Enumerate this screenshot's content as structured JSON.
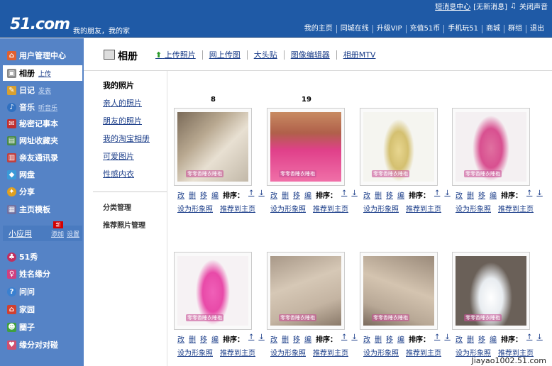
{
  "header": {
    "top_links": [
      "短消息中心",
      "[无新消息]",
      "关闭声音"
    ],
    "logo": "51.com",
    "slogan": "我的朋友，我的家",
    "nav": [
      "我的主页",
      "同城在线",
      "升级VIP",
      "充值51币",
      "手机玩51",
      "商城",
      "群组",
      "退出"
    ]
  },
  "sidebar": {
    "items": [
      {
        "label": "用户管理中心",
        "sub": ""
      },
      {
        "label": "相册",
        "sub": "上传"
      },
      {
        "label": "日记",
        "sub": "发表"
      },
      {
        "label": "音乐",
        "sub": "听音乐"
      },
      {
        "label": "秘密记事本",
        "sub": ""
      },
      {
        "label": "网址收藏夹",
        "sub": ""
      },
      {
        "label": "亲友通讯录",
        "sub": ""
      },
      {
        "label": "网盘",
        "sub": ""
      },
      {
        "label": "分享",
        "sub": ""
      },
      {
        "label": "主页模板",
        "sub": ""
      }
    ],
    "apps_title": "小应用",
    "apps_add": "添加",
    "apps_settings": "设置",
    "new_badge": "新",
    "apps": [
      "51秀",
      "姓名缘分",
      "问问",
      "家园",
      "圈子",
      "缘分对对碰"
    ]
  },
  "page": {
    "title": "相册",
    "subnav": [
      "上传照片",
      "网上传图",
      "大头贴",
      "图像编辑器",
      "相册MTV"
    ]
  },
  "left_menu": {
    "heading": "我的照片",
    "links": [
      "亲人的照片",
      "朋友的照片",
      "我的淘宝相册",
      "可爱图片",
      "性感内衣"
    ],
    "manage": [
      "分类管理",
      "推荐照片管理"
    ]
  },
  "photos": {
    "counts": [
      "8",
      "19"
    ],
    "actions": [
      "改",
      "删",
      "移",
      "编"
    ],
    "sort_label": "排序：",
    "sort_arrows": [
      "↑",
      "↓"
    ],
    "set_avatar": "设为形象照",
    "recommend": "推荐到主页",
    "watermark_text": "零零香睡衣睡袍"
  },
  "footer_watermark": "Jiayao1002.51.com",
  "colors": {
    "header_bg": "#1f5aa6",
    "sidebar_bg": "#5583c6",
    "link": "#1d3f8a"
  }
}
